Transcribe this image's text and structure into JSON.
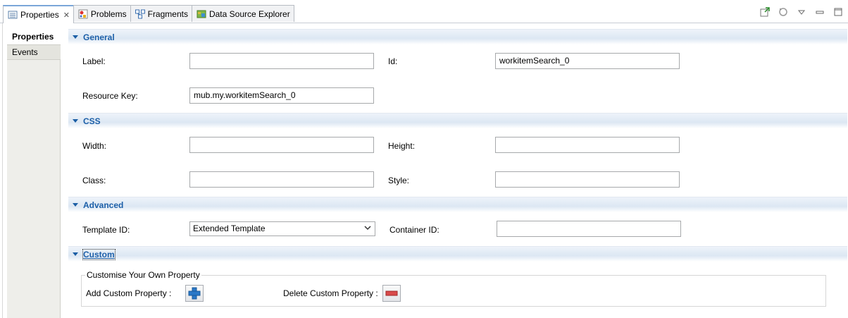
{
  "tabs": [
    {
      "label": "Properties",
      "icon": "properties-icon",
      "active": true
    },
    {
      "label": "Problems",
      "icon": "problems-icon"
    },
    {
      "label": "Fragments",
      "icon": "fragments-icon"
    },
    {
      "label": "Data Source Explorer",
      "icon": "data-source-explorer-icon"
    }
  ],
  "toolbar": {
    "icons": [
      "pin-view-icon",
      "sync-icon",
      "view-menu-icon",
      "minimize-icon",
      "maximize-icon"
    ]
  },
  "sidenav": {
    "items": [
      {
        "label": "Properties"
      },
      {
        "label": "Events"
      }
    ]
  },
  "sections": {
    "general": {
      "title": "General",
      "label_label": "Label:",
      "label_value": "",
      "id_label": "Id:",
      "id_value": "workitemSearch_0",
      "resource_key_label": "Resource Key:",
      "resource_key_value": "mub.my.workitemSearch_0"
    },
    "css": {
      "title": "CSS",
      "width_label": "Width:",
      "width_value": "",
      "height_label": "Height:",
      "height_value": "",
      "class_label": "Class:",
      "class_value": "",
      "style_label": "Style:",
      "style_value": ""
    },
    "advanced": {
      "title": "Advanced",
      "template_id_label": "Template ID:",
      "template_id_value": "Extended Template",
      "container_id_label": "Container ID:",
      "container_id_value": ""
    },
    "custom": {
      "title": "Custom",
      "group_title": "Customise Your Own Property",
      "add_label": "Add Custom Property :",
      "delete_label": "Delete Custom Property :"
    }
  },
  "colors": {
    "section_title": "#1c5fa8",
    "add_button": "#2a78c8",
    "delete_button": "#d94a4a"
  }
}
